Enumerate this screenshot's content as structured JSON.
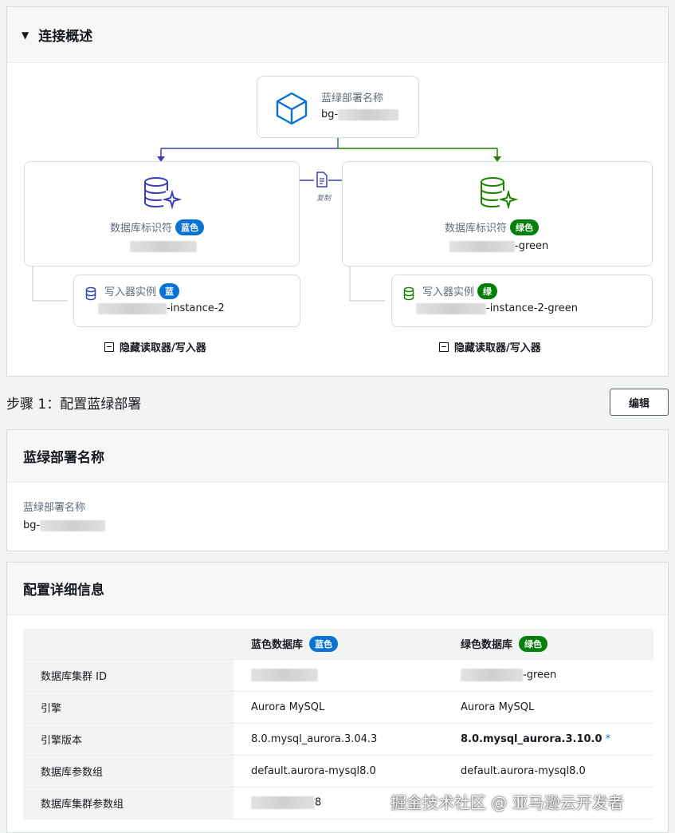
{
  "overview": {
    "title": "连接概述",
    "bg_card": {
      "label": "蓝绿部署名称",
      "value": "bg-"
    },
    "blue_db": {
      "label": "数据库标识符",
      "badge": "蓝色"
    },
    "green_db": {
      "label": "数据库标识符",
      "badge": "绿色",
      "value_suffix": "-green"
    },
    "copy_label": "复制",
    "blue_instance": {
      "label": "写入器实例",
      "badge": "蓝",
      "value_suffix": "-instance-2"
    },
    "green_instance": {
      "label": "写入器实例",
      "badge": "绿",
      "value_suffix": "-instance-2-green"
    },
    "hide_toggle": "隐藏读取器/写入器"
  },
  "step": {
    "title": "步骤 1：配置蓝绿部署",
    "edit_label": "编辑"
  },
  "name_panel": {
    "title": "蓝绿部署名称",
    "key": "蓝绿部署名称",
    "value": "bg-"
  },
  "details_panel": {
    "title": "配置详细信息",
    "columns": {
      "blue": "蓝色数据库",
      "blue_badge": "蓝色",
      "green": "绿色数据库",
      "green_badge": "绿色"
    },
    "rows": [
      {
        "key": "数据库集群 ID",
        "blue": "",
        "green": "-green"
      },
      {
        "key": "引擎",
        "blue": "Aurora MySQL",
        "green": "Aurora MySQL"
      },
      {
        "key": "引擎版本",
        "blue": "8.0.mysql_aurora.3.04.3",
        "green": "8.0.mysql_aurora.3.10.0",
        "green_marker": "*"
      },
      {
        "key": "数据库参数组",
        "blue": "default.aurora-mysql8.0",
        "green": "default.aurora-mysql8.0"
      },
      {
        "key": "数据库集群参数组",
        "blue": "8",
        "green": ""
      }
    ]
  },
  "watermark": "掘金技术社区 @ 亚马逊云开发者",
  "colors": {
    "blue": "#0972d3",
    "green": "#037f0c",
    "arrow_blue": "#3f3fb5",
    "arrow_green": "#1d8102"
  }
}
